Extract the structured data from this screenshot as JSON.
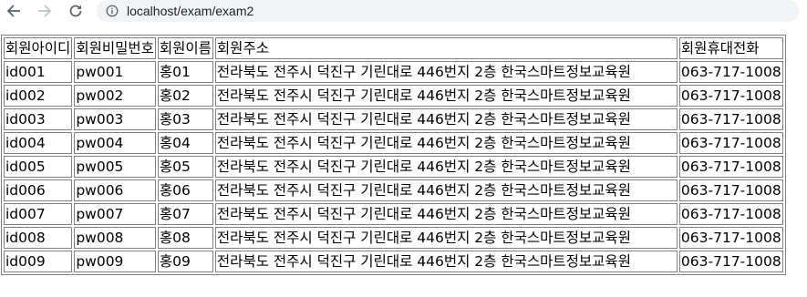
{
  "browser": {
    "url": "localhost/exam/exam2"
  },
  "table": {
    "headers": [
      "회원아이디",
      "회원비밀번호",
      "회원이름",
      "회원주소",
      "회원휴대전화"
    ],
    "rows": [
      [
        "id001",
        "pw001",
        "홍01",
        "전라북도 전주시 덕진구 기린대로 446번지 2층 한국스마트정보교육원",
        "063-717-1008"
      ],
      [
        "id002",
        "pw002",
        "홍02",
        "전라북도 전주시 덕진구 기린대로 446번지 2층 한국스마트정보교육원",
        "063-717-1008"
      ],
      [
        "id003",
        "pw003",
        "홍03",
        "전라북도 전주시 덕진구 기린대로 446번지 2층 한국스마트정보교육원",
        "063-717-1008"
      ],
      [
        "id004",
        "pw004",
        "홍04",
        "전라북도 전주시 덕진구 기린대로 446번지 2층 한국스마트정보교육원",
        "063-717-1008"
      ],
      [
        "id005",
        "pw005",
        "홍05",
        "전라북도 전주시 덕진구 기린대로 446번지 2층 한국스마트정보교육원",
        "063-717-1008"
      ],
      [
        "id006",
        "pw006",
        "홍06",
        "전라북도 전주시 덕진구 기린대로 446번지 2층 한국스마트정보교육원",
        "063-717-1008"
      ],
      [
        "id007",
        "pw007",
        "홍07",
        "전라북도 전주시 덕진구 기린대로 446번지 2층 한국스마트정보교육원",
        "063-717-1008"
      ],
      [
        "id008",
        "pw008",
        "홍08",
        "전라북도 전주시 덕진구 기린대로 446번지 2층 한국스마트정보교육원",
        "063-717-1008"
      ],
      [
        "id009",
        "pw009",
        "홍09",
        "전라북도 전주시 덕진구 기린대로 446번지 2층 한국스마트정보교육원",
        "063-717-1008"
      ]
    ]
  },
  "icons": {
    "back": "back-arrow-icon",
    "forward": "forward-arrow-icon",
    "reload": "reload-icon",
    "info": "info-icon"
  }
}
